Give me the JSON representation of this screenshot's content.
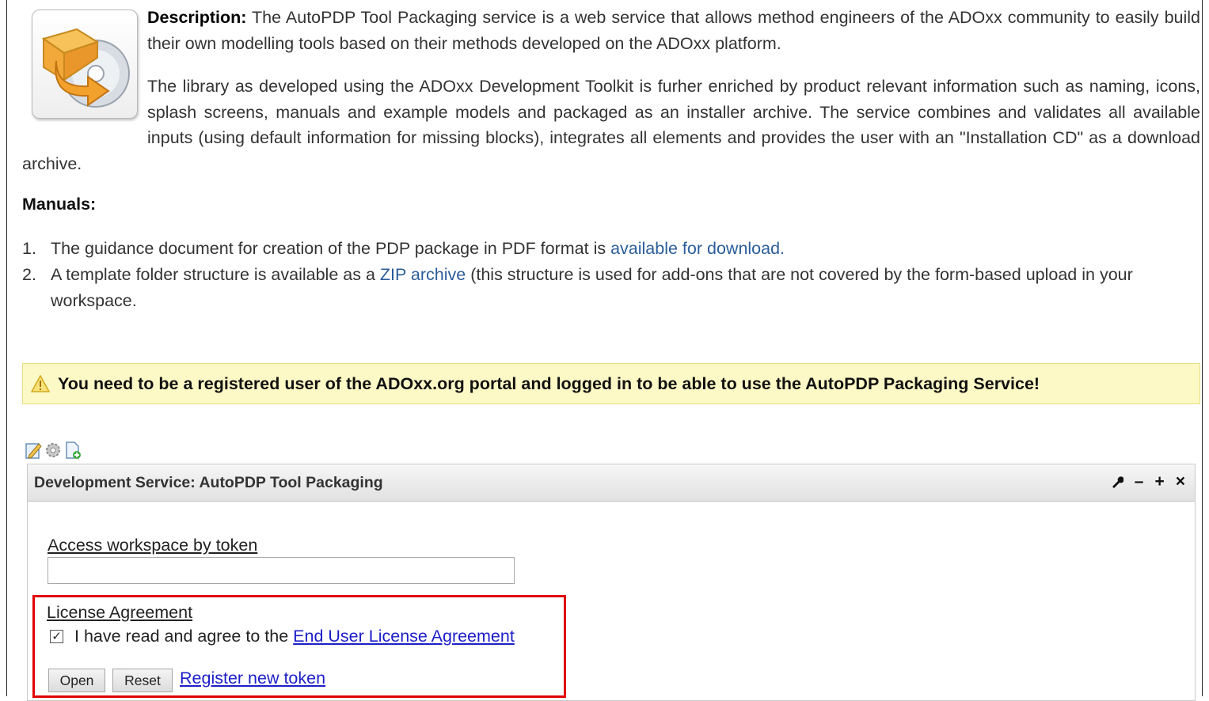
{
  "description": {
    "label": "Description:",
    "para1": "The AutoPDP Tool Packaging service is a web service that allows method engineers of the ADOxx community to easily build their own modelling tools based on their methods developed on the ADOxx platform.",
    "para2": "The library as developed using the ADOxx Development Toolkit is furher enriched by product relevant information such as naming, icons, splash screens, manuals and example models and packaged as an installer archive. The service combines and validates all available inputs (using default information for missing blocks), integrates all elements and provides the user with an \"Installation CD\" as a download archive."
  },
  "manuals": {
    "title": "Manuals:",
    "items": [
      {
        "num": "1.",
        "text_before": "The guidance document for creation of the PDP package in PDF format is ",
        "link": "available for download.",
        "text_after": ""
      },
      {
        "num": "2.",
        "text_before": "A template folder structure is available as a ",
        "link": "ZIP archive",
        "text_after": " (this structure is used for add-ons that are not covered by the form-based upload in your workspace."
      }
    ]
  },
  "warning": {
    "icon": "warning-icon",
    "text": "You need to be a registered user of the ADOxx.org portal and logged in to be able to use the AutoPDP Packaging Service!"
  },
  "portlet": {
    "title": "Development Service: AutoPDP Tool Packaging",
    "controls": [
      "wrench-icon",
      "minimize-icon",
      "maximize-icon",
      "close-icon"
    ],
    "toolbar_icons": [
      "edit-icon",
      "gear-icon",
      "add-page-icon"
    ]
  },
  "form": {
    "token_label": "Access workspace by token",
    "token_value": "",
    "license_label": "License Agreement",
    "agree_text": "I have read and agree to the",
    "agree_checked": true,
    "eula_link": "End User License Agreement",
    "open_button": "Open",
    "reset_button": "Reset",
    "register_link": "Register new token"
  },
  "colors": {
    "link": "#2b5d9a",
    "form_link": "#1c1ec8",
    "warning_bg": "#fdf9c6",
    "highlight": "#e00000"
  }
}
